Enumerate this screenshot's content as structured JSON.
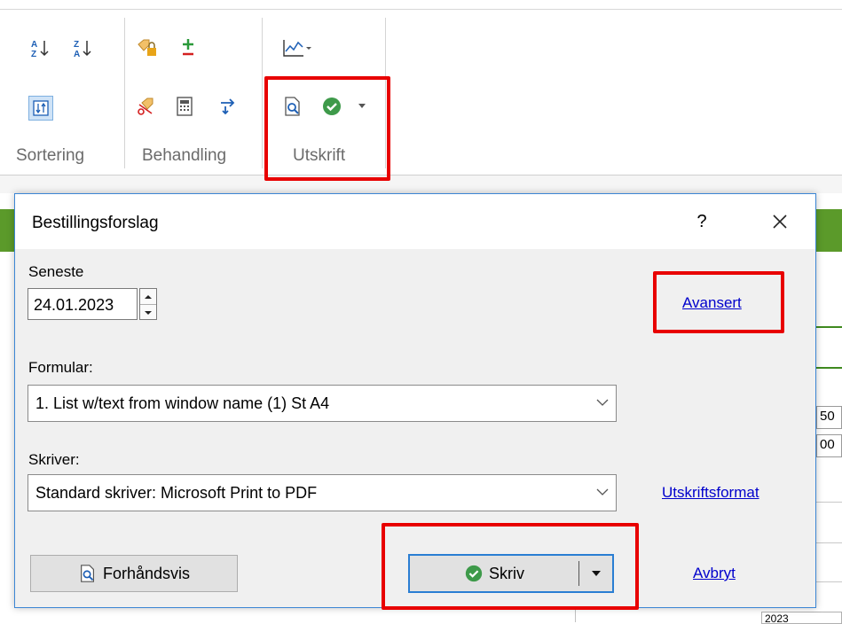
{
  "ribbon": {
    "groups": [
      {
        "label": "Sortering",
        "icons": [
          "sort-ascending-icon",
          "sort-descending-icon",
          "sort-toggle-icon"
        ]
      },
      {
        "label": "Behandling",
        "icons": [
          "lock-tag-icon",
          "plus-minus-icon",
          "scissors-tag-icon",
          "calculator-icon",
          "transfer-icon"
        ]
      },
      {
        "label": "Utskrift",
        "icons": [
          "chart-dropdown-icon",
          "print-preview-icon",
          "print-check-icon",
          "dropdown-arrow-icon"
        ]
      }
    ]
  },
  "background": {
    "cell_1": "50",
    "cell_2": "00",
    "bottom_text": "2023"
  },
  "dialog": {
    "title": "Bestillingsforslag",
    "help": "?",
    "seneste_label": "Seneste",
    "seneste_value": "24.01.2023",
    "avansert_link": "Avansert",
    "formular_label": "Formular:",
    "formular_value": "1. List w/text from window name (1) St A4",
    "skriver_label": "Skriver:",
    "skriver_value": "Standard skriver: Microsoft Print to PDF",
    "utskriftsformat_link": "Utskriftsformat",
    "preview_button": "Forhåndsvis",
    "print_button": "Skriv",
    "cancel_link": "Avbryt"
  },
  "colors": {
    "highlight": "#e80000",
    "accent_blue": "#2a7ed3",
    "link": "#0000cc",
    "green_band": "#5b9a2a"
  }
}
